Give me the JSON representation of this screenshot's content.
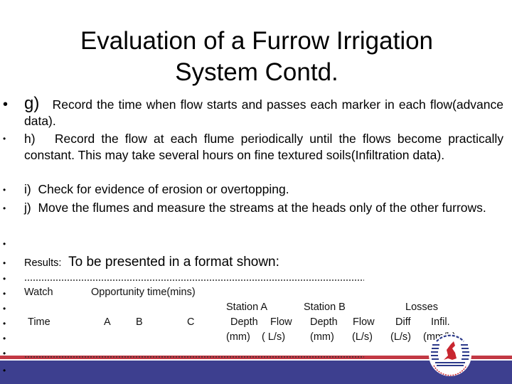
{
  "slide": {
    "title_line1": "Evaluation of a Furrow Irrigation",
    "title_line2": "System Contd.",
    "colors": {
      "footer_red": "#c23844",
      "footer_blue": "#3d3f8f",
      "background": "#ffffff"
    }
  },
  "bullets": [
    {
      "label": "g)",
      "text": "Record the time when flow starts and passes each marker in each flow(advance data)."
    },
    {
      "label": "h)",
      "text": "Record the flow at each flume periodically until the flows become practically constant.  This may take several hours on fine textured soils(Infiltration data)."
    },
    {
      "label": "i)",
      "text": "Check for evidence of erosion or overtopping."
    },
    {
      "label": "j)",
      "text": "Move the flumes and measure the streams at the heads only of the other furrows."
    }
  ],
  "results": {
    "label": "Results",
    "colon": ":",
    "text": "To be presented in a format shown:"
  },
  "table_format": {
    "row1": {
      "watch": "Watch",
      "opportunity": "Opportunity time(mins)"
    },
    "row2": {
      "station_a": "Station A",
      "station_b": "Station B",
      "losses": "Losses"
    },
    "row3": {
      "time": "Time",
      "a": "A",
      "b": "B",
      "c": "C",
      "depth_a": "Depth",
      "flow_a": "Flow",
      "depth_b": "Depth",
      "flow_b": "Flow",
      "diff": "Diff",
      "infil": "Infil."
    },
    "row4": {
      "mm_a": "(mm)",
      "ls_a": "( L/s)",
      "mm_b": "(mm)",
      "ls_b": "(L/s)",
      "ls_diff": "(L/s)",
      "mmh": "(mm/h)"
    }
  },
  "logo": {
    "icon": "university-logo-icon"
  }
}
